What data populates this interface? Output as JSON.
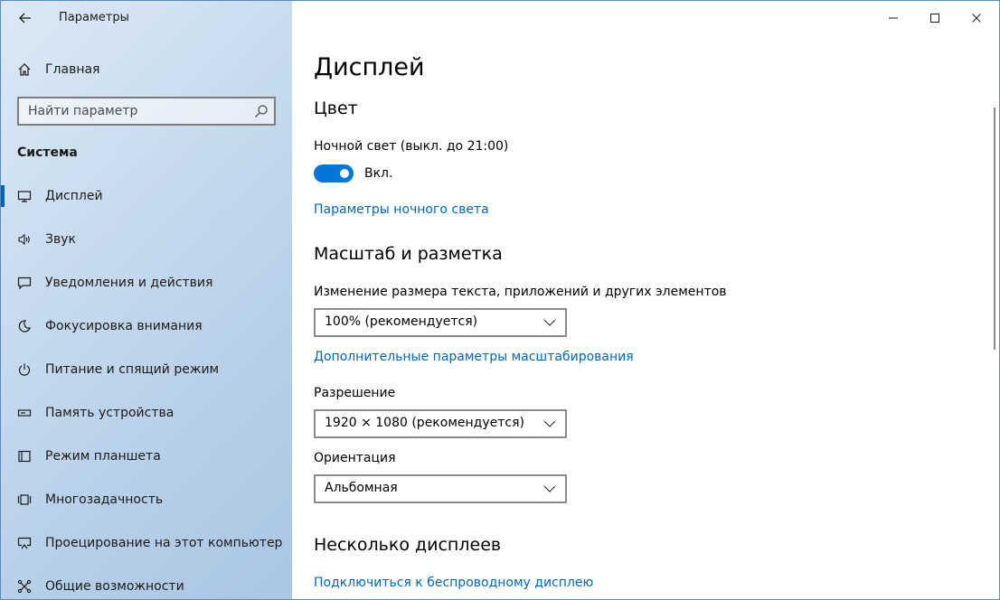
{
  "window": {
    "title": "Параметры",
    "controls": [
      "minimize",
      "maximize",
      "close"
    ]
  },
  "sidebar": {
    "home_label": "Главная",
    "search_placeholder": "Найти параметр",
    "section_title": "Система",
    "items": [
      {
        "label": "Дисплей",
        "icon": "monitor-icon",
        "active": true
      },
      {
        "label": "Звук",
        "icon": "speaker-icon"
      },
      {
        "label": "Уведомления и действия",
        "icon": "notification-icon"
      },
      {
        "label": "Фокусировка внимания",
        "icon": "moon-icon"
      },
      {
        "label": "Питание и спящий режим",
        "icon": "power-icon"
      },
      {
        "label": "Память устройства",
        "icon": "storage-icon"
      },
      {
        "label": "Режим планшета",
        "icon": "tablet-icon"
      },
      {
        "label": "Многозадачность",
        "icon": "multitasking-icon"
      },
      {
        "label": "Проецирование на этот компьютер",
        "icon": "projection-icon"
      },
      {
        "label": "Общие возможности",
        "icon": "shared-icon"
      }
    ]
  },
  "main": {
    "page_title": "Дисплей",
    "color_section": "Цвет",
    "night_light_label": "Ночной свет (выкл. до 21:00)",
    "night_light_toggle_state": "Вкл.",
    "night_light_on": true,
    "night_light_settings_link": "Параметры ночного света",
    "scale_section": "Масштаб и разметка",
    "scale_label": "Изменение размера текста, приложений и других элементов",
    "scale_value": "100% (рекомендуется)",
    "advanced_scale_link": "Дополнительные параметры масштабирования",
    "resolution_label": "Разрешение",
    "resolution_value": "1920 × 1080 (рекомендуется)",
    "orientation_label": "Ориентация",
    "orientation_value": "Альбомная",
    "multi_display_section": "Несколько дисплеев",
    "wireless_link": "Подключиться к беспроводному дисплею"
  },
  "colors": {
    "accent": "#0078d7",
    "link": "#0067b8"
  }
}
